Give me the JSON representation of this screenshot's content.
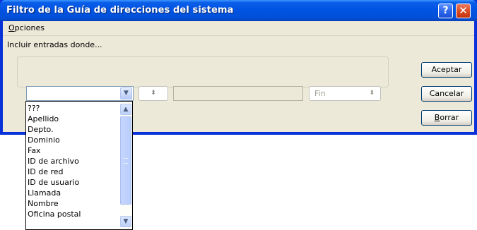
{
  "window": {
    "title": "Filtro de la Guía de direcciones del sistema",
    "help_glyph": "?",
    "close_glyph": "✕"
  },
  "menu": {
    "options_underlined": "O",
    "options_rest": "pciones"
  },
  "filter": {
    "label": "Incluir entradas donde...",
    "field_value": "",
    "condition_value": "",
    "search_value": "",
    "end_value": "Fin"
  },
  "buttons": {
    "accept": "Aceptar",
    "cancel": "Cancelar",
    "clear_underlined": "B",
    "clear_rest": "orrar"
  },
  "dropdown_list": {
    "items": [
      "???",
      "Apellido",
      "Depto.",
      "Dominio",
      "Fax",
      "ID de archivo",
      "ID de red",
      "ID de usuario",
      "Llamada",
      "Nombre",
      "Oficina postal"
    ]
  },
  "icons": {
    "dropdown_arrow": "chevron-down-icon",
    "spinner": "up-down-arrows-icon",
    "scroll_up": "chevron-up-icon",
    "scroll_down": "chevron-down-icon"
  },
  "colors": {
    "titlebar": "#0054e3",
    "client_bg": "#ece9d8",
    "close_button": "#d9461e",
    "button_border": "#003c74"
  }
}
